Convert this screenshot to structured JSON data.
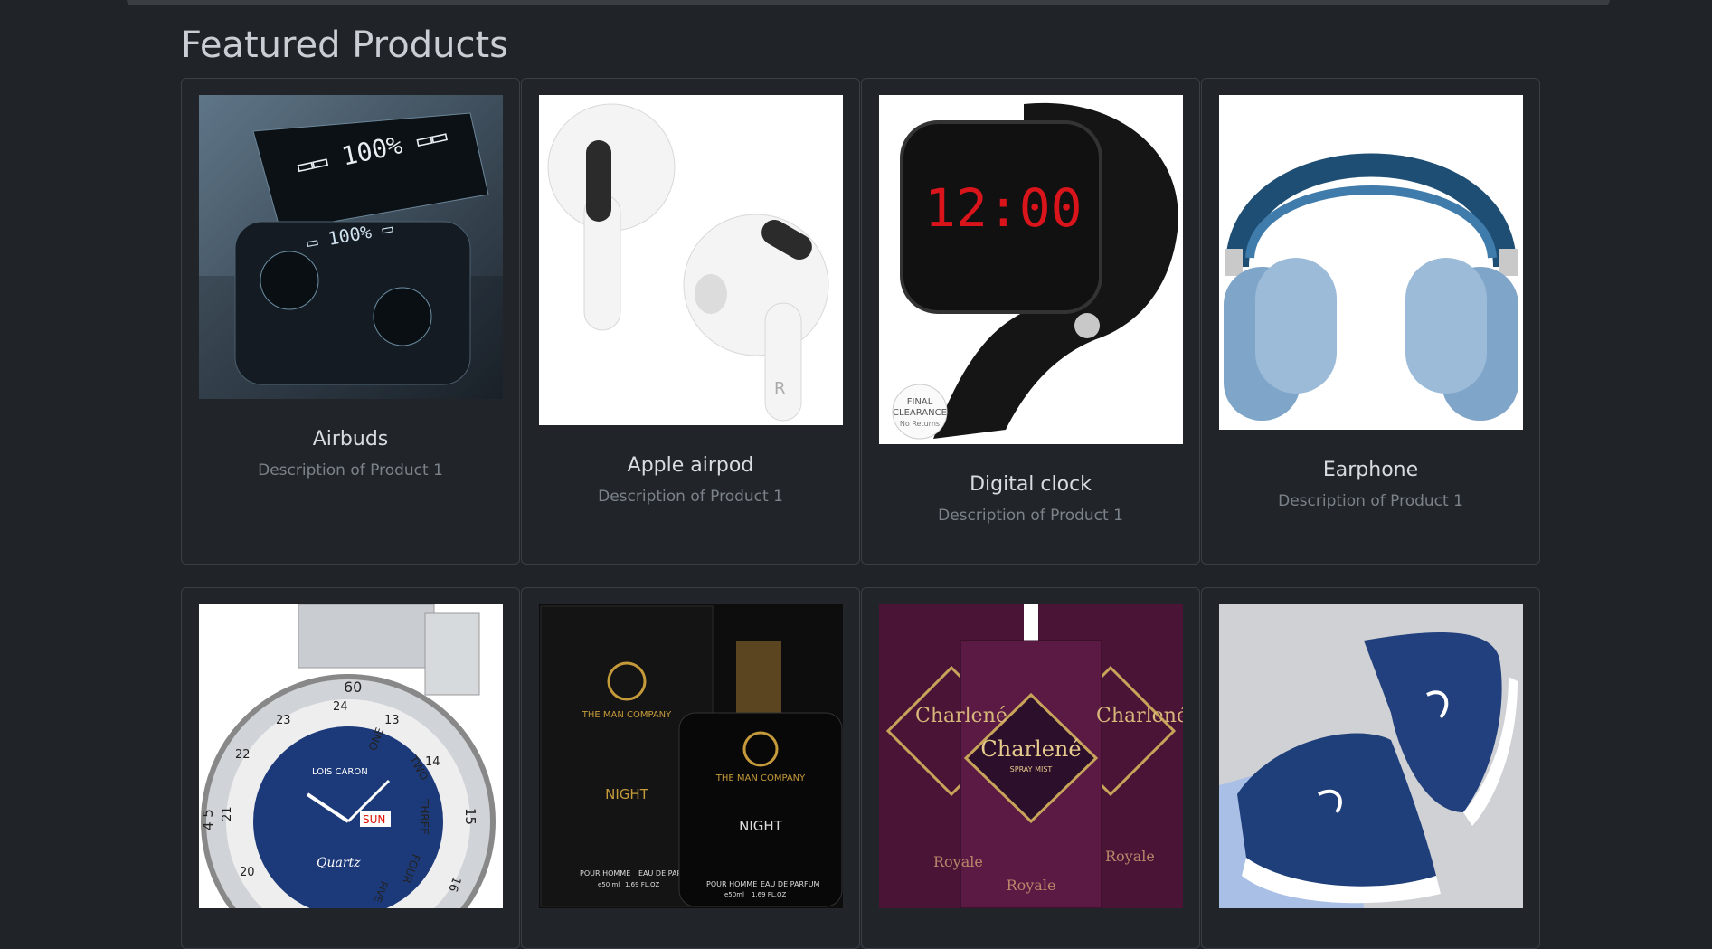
{
  "page": {
    "heading": "Featured Products"
  },
  "products": [
    {
      "name": "Airbuds",
      "description": "Description of Product 1"
    },
    {
      "name": "Apple airpod",
      "description": "Description of Product 1"
    },
    {
      "name": "Digital clock",
      "description": "Description of Product 1"
    },
    {
      "name": "Earphone",
      "description": "Description of Product 1"
    }
  ],
  "products_row2": [
    {
      "image_text": [
        "60",
        "24",
        "23",
        "13",
        "ONE",
        "TWO",
        "14",
        "THREE",
        "15",
        "FOUR",
        "16",
        "FIVE",
        "22",
        "21",
        "20",
        "4 5",
        "LOIS CARON",
        "SUN",
        "Quartz"
      ]
    },
    {
      "image_text": [
        "THE MAN COMPANY",
        "NIGHT",
        "POUR HOMME",
        "EAU DE PARFUM",
        "e50 ml",
        "1.69 FL.OZ",
        "THE MAN COMPANY",
        "NIGHT",
        "POUR HOMME",
        "EAU DE PARFUM",
        "e50ml",
        "1.69 FL.OZ"
      ]
    },
    {
      "image_text": [
        "Charlené",
        "SPRAY MIST",
        "Royale"
      ]
    },
    {
      "image_text": []
    }
  ],
  "product_badges": {
    "digital_clock": [
      "FINAL",
      "CLEARANCE",
      "No Returns"
    ],
    "watch_time": "12:00"
  },
  "colors": {
    "background": "#202327",
    "card_border": "#3b3f45",
    "title": "#c9ced4",
    "desc": "#7b828a"
  }
}
